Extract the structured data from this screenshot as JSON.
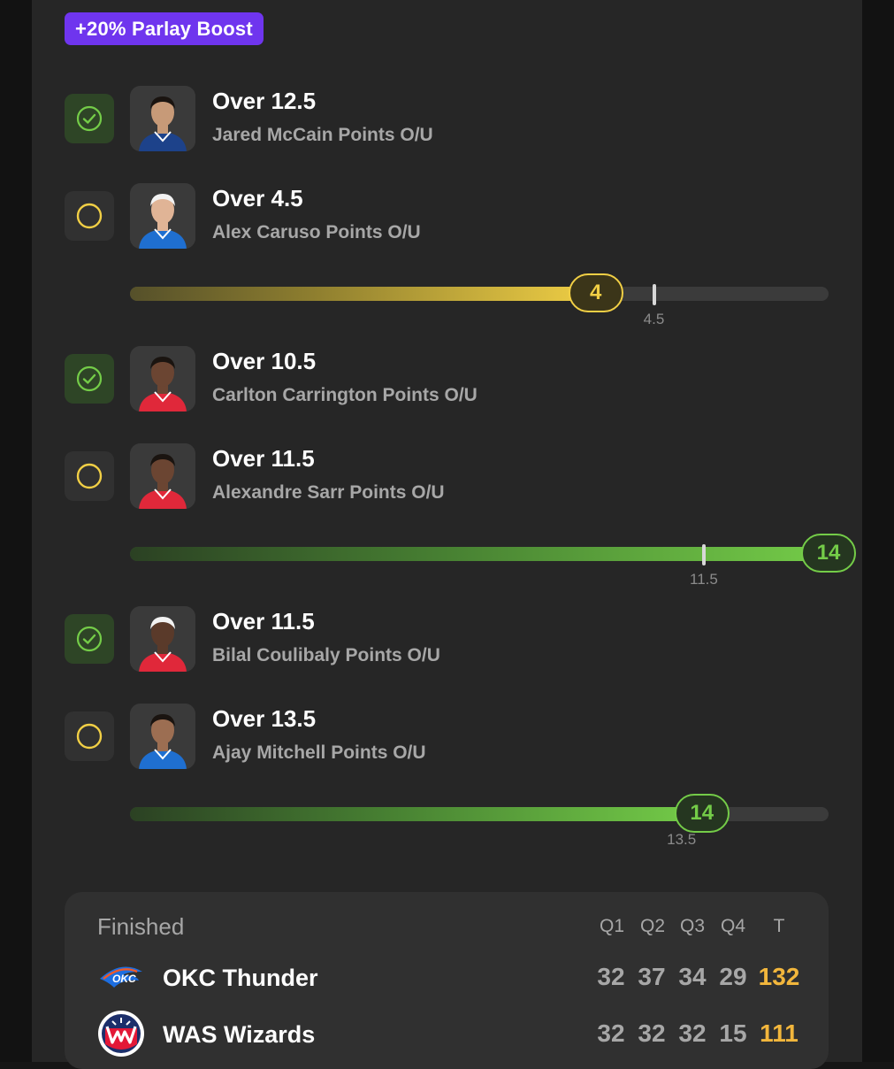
{
  "boost_badge": "+20% Parlay Boost",
  "legs": [
    {
      "status": "won",
      "line": "Over 12.5",
      "market": "Jared McCain Points O/U",
      "jersey_color": "#1d428a",
      "skin": "#c79a78",
      "hair": "#1a1410"
    },
    {
      "status": "pending",
      "line": "Over 4.5",
      "market": "Alex Caruso Points O/U",
      "jersey_color": "#1f6fd0",
      "skin": "#e0b496",
      "hair": "#f2f2f2",
      "progress": {
        "current": "4",
        "target": "4.5",
        "current_value": 4,
        "target_value": 4.5,
        "max_value": 6.0,
        "color": "yellow"
      }
    },
    {
      "status": "won",
      "line": "Over 10.5",
      "market": "Carlton Carrington Points O/U",
      "jersey_color": "#e0283a",
      "skin": "#6b4532",
      "hair": "#1a1410"
    },
    {
      "status": "pending",
      "line": "Over 11.5",
      "market": "Alexandre Sarr Points O/U",
      "jersey_color": "#e0283a",
      "skin": "#6b4532",
      "hair": "#1a1410",
      "progress": {
        "current": "14",
        "target": "11.5",
        "current_value": 14,
        "target_value": 11.5,
        "max_value": 14.0,
        "color": "green"
      }
    },
    {
      "status": "won",
      "line": "Over 11.5",
      "market": "Bilal Coulibaly Points O/U",
      "jersey_color": "#e0283a",
      "skin": "#5a3a2a",
      "hair": "#f2f2f2"
    },
    {
      "status": "pending",
      "line": "Over 13.5",
      "market": "Ajay Mitchell Points O/U",
      "jersey_color": "#1f6fd0",
      "skin": "#9c6e52",
      "hair": "#1a1410",
      "progress": {
        "current": "14",
        "target": "13.5",
        "current_value": 14,
        "target_value": 13.5,
        "max_value": 17.1,
        "color": "green"
      }
    }
  ],
  "scoreboard": {
    "status": "Finished",
    "headers": [
      "Q1",
      "Q2",
      "Q3",
      "Q4",
      "T"
    ],
    "teams": [
      {
        "name": "OKC Thunder",
        "logo": "okc-thunder-logo",
        "quarters": [
          "32",
          "37",
          "34",
          "29"
        ],
        "total": "132"
      },
      {
        "name": "WAS Wizards",
        "logo": "was-wizards-logo",
        "quarters": [
          "32",
          "32",
          "32",
          "15"
        ],
        "total": "111"
      }
    ]
  },
  "colors": {
    "accent_purple": "#6f35ee",
    "won_green": "#74cc48",
    "pending_yellow": "#f1cf45",
    "total_orange": "#f2b63c"
  }
}
